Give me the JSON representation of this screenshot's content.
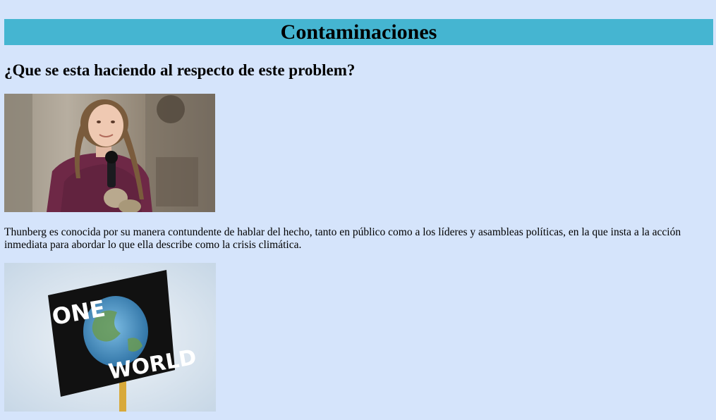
{
  "header": {
    "title": "Contaminaciones"
  },
  "section": {
    "heading": "¿Que se esta haciendo al respecto de este problem?",
    "paragraph": "Thunberg es conocida por su manera contundente de hablar del hecho, tanto en público como a los líderes y asambleas políticas, en la que insta a la acción inmediata para abordar lo que ella describe como la crisis climática."
  },
  "images": {
    "first": "photo-girl-with-microphone",
    "second": "photo-one-world-protest-sign",
    "sign_text_top": "ONE",
    "sign_text_bottom": "WORLD"
  },
  "colors": {
    "background": "#d5e4fb",
    "header_bar": "#45b5d1"
  }
}
